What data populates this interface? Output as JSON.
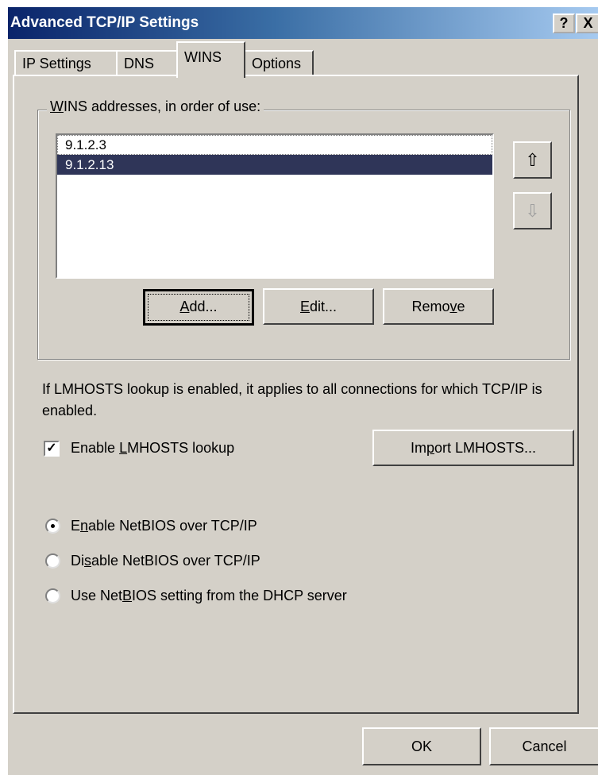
{
  "window": {
    "title": "Advanced TCP/IP Settings",
    "help_button": "?",
    "close_button": "X"
  },
  "tabs": [
    {
      "label": "IP Settings"
    },
    {
      "label": "DNS"
    },
    {
      "label": "WINS",
      "active": true
    },
    {
      "label": "Options"
    }
  ],
  "wins": {
    "group_label": "WINS addresses, in order of use:",
    "group_label_mnemonic": "W",
    "addresses": [
      {
        "value": "9.1.2.3",
        "selected": false
      },
      {
        "value": "9.1.2.13",
        "selected": true
      }
    ],
    "move_up_icon": "arrow-up-icon",
    "move_down_icon": "arrow-down-icon",
    "add_label": "Add...",
    "edit_label": "Edit...",
    "remove_label": "Remove"
  },
  "lmhosts": {
    "info_text": "If LMHOSTS lookup is enabled, it applies to all connections for which TCP/IP is enabled.",
    "checkbox_label": "Enable LMHOSTS lookup",
    "checked": true,
    "import_label": "Import LMHOSTS..."
  },
  "netbios": {
    "options": [
      {
        "label": "Enable NetBIOS over TCP/IP",
        "selected": true
      },
      {
        "label": "Disable NetBIOS over TCP/IP",
        "selected": false
      },
      {
        "label": "Use NetBIOS setting from the DHCP server",
        "selected": false
      }
    ]
  },
  "footer": {
    "ok_label": "OK",
    "cancel_label": "Cancel"
  }
}
